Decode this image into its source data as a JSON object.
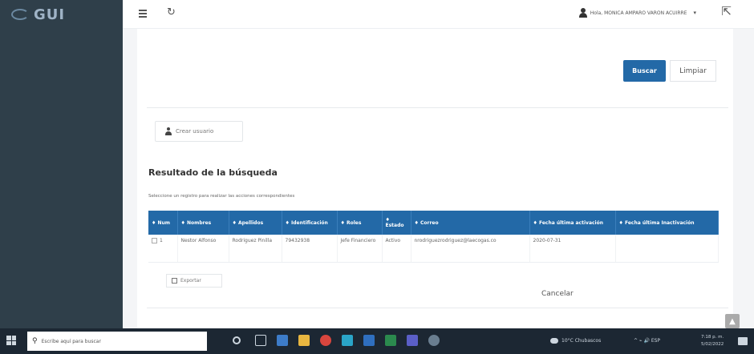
{
  "app": {
    "logo_text": "GUI"
  },
  "header": {
    "user_name": "Hola, MONICA AMPARO VARON ACUIRRE",
    "caret": "▾"
  },
  "filters": {
    "search_button": "Buscar",
    "clear_button": "Limpiar"
  },
  "actions": {
    "create_user": "Crear usuario"
  },
  "results": {
    "title": "Resultado de la búsqueda",
    "subtitle": "Seleccione un registro para realizar las acciones correspondientes",
    "columns": [
      "♦ Num",
      "♦ Nombres",
      "♦ Apellidos",
      "♦ Identificación",
      "♦ Roles",
      "♦ Estado",
      "♦ Correo",
      "♦ Fecha última activación",
      "♦ Fecha última Inactivación"
    ],
    "rows": [
      {
        "num": "1",
        "nombres": "Nestor Alfonso",
        "apellidos": "Rodriguez Pinilla",
        "identificacion": "79432938",
        "roles": "Jefe Financiero",
        "estado": "Activo",
        "correo": "nrodriguezrodriguez@laecogas.co",
        "fecha_activacion": "2020-07-31",
        "fecha_inactivacion": ""
      }
    ],
    "export_button": "Exportar"
  },
  "footer": {
    "cancel_button": "Cancelar"
  },
  "taskbar": {
    "search_placeholder": "Escribe aquí para buscar",
    "weather": "10°C Chubascos",
    "tray_icons": "^ ⌁ 🔊 ESP",
    "time": "7:18 p. m.",
    "date": "5/02/2022"
  },
  "colors": {
    "sidebar": "#2f3f4a",
    "primary": "#2369a7",
    "taskbar": "#1c2733"
  }
}
